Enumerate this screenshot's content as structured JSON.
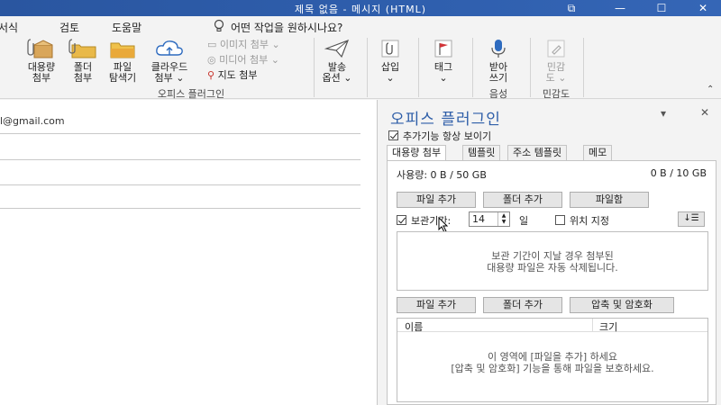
{
  "window": {
    "title": "제목 없음  -  메시지 (HTML)",
    "controls": {
      "restore": "⧉",
      "minimize": "—",
      "maximize": "☐",
      "close": "✕"
    }
  },
  "menu": {
    "items": [
      "서식",
      "검토",
      "도움말"
    ],
    "tell_me": "어떤 작업을 원하시나요?"
  },
  "ribbon": {
    "large": {
      "large_attach": "대용량\n첨부",
      "folder_attach": "폴더\n첨부",
      "file_explorer": "파일\n탐색기",
      "cloud_attach": "클라우드\n첨부 ⌄",
      "send_options": "발송\n옵션 ⌄",
      "insert": "삽입\n⌄",
      "tag": "태그\n⌄",
      "dictation": "받아\n쓰기",
      "sensitivity": "민감\n도 ⌄"
    },
    "small": {
      "image_attach": "이미지 첨부 ⌄",
      "media_attach": "미디어 첨부 ⌄",
      "map_attach": "지도 첨부"
    },
    "groups": {
      "office_plugin": "오피스 플러그인",
      "voice": "음성",
      "sensitivity": "민감도"
    }
  },
  "compose": {
    "to_value": "l@gmail.com"
  },
  "pane": {
    "title": "오피스 플러그인",
    "controls": {
      "dropdown": "▾",
      "close": "✕"
    },
    "always_show": "추가기능 항상 보이기",
    "tabs": [
      "대용량 첨부",
      "템플릿",
      "주소 템플릿",
      "메모"
    ],
    "usage_label": "사용량: 0 B / 50 GB",
    "usage_right": "0 B / 10 GB",
    "buttons_top": [
      "파일 추가",
      "폴더 추가",
      "파일함"
    ],
    "retention_label": "보관기간:",
    "retention_value": "14",
    "retention_unit": "일",
    "position_label": "위치 지정",
    "retention_msg": [
      "보관 기간이 지날 경우 첨부된",
      "대용량 파일은 자동 삭제됩니다."
    ],
    "buttons_bottom": [
      "파일 추가",
      "폴더 추가",
      "압축 및 암호화"
    ],
    "columns": [
      "이름",
      "크기"
    ],
    "list_msg": [
      "이 영역에 [파일을 추가] 하세요",
      "[압축 및 암호화] 기능을 통해 파일을 보호하세요."
    ]
  },
  "colors": {
    "titlebar": "#2b5797",
    "accent": "#2e5ea8",
    "pane_bg": "#f3f3f3"
  }
}
